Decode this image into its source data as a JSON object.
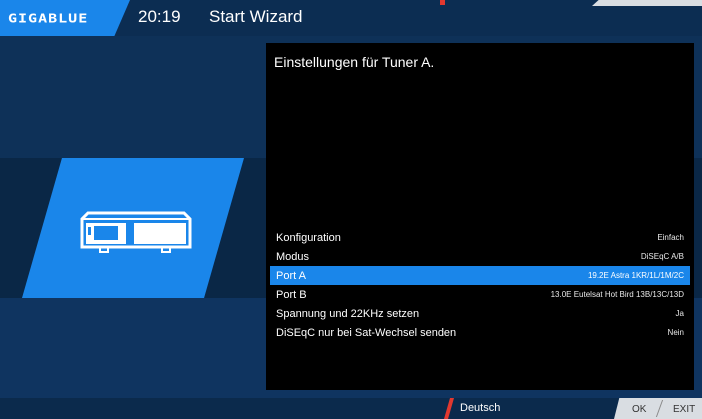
{
  "header": {
    "logo": "GIGABLUE",
    "time": "20:19",
    "title": "Start Wizard"
  },
  "panel": {
    "title": "Einstellungen für Tuner A."
  },
  "settings": [
    {
      "label": "Konfiguration",
      "value": "Einfach",
      "selected": false
    },
    {
      "label": "Modus",
      "value": "DiSEqC A/B",
      "selected": false
    },
    {
      "label": "Port A",
      "value": "19.2E Astra 1KR/1L/1M/2C",
      "selected": true
    },
    {
      "label": "Port B",
      "value": "13.0E Eutelsat Hot Bird 13B/13C/13D",
      "selected": false
    },
    {
      "label": "Spannung und 22KHz setzen",
      "value": "Ja",
      "selected": false
    },
    {
      "label": "DiSEqC nur bei Sat-Wechsel senden",
      "value": "Nein",
      "selected": false
    }
  ],
  "footer": {
    "language": "Deutsch",
    "ok_label": "OK",
    "exit_label": "EXIT"
  },
  "colors": {
    "accent": "#1a86ea",
    "red_key": "#e2382f",
    "background": "#0b2a4c",
    "panel": "#000000"
  },
  "icons": {
    "tuner": "satellite-receiver-icon"
  }
}
